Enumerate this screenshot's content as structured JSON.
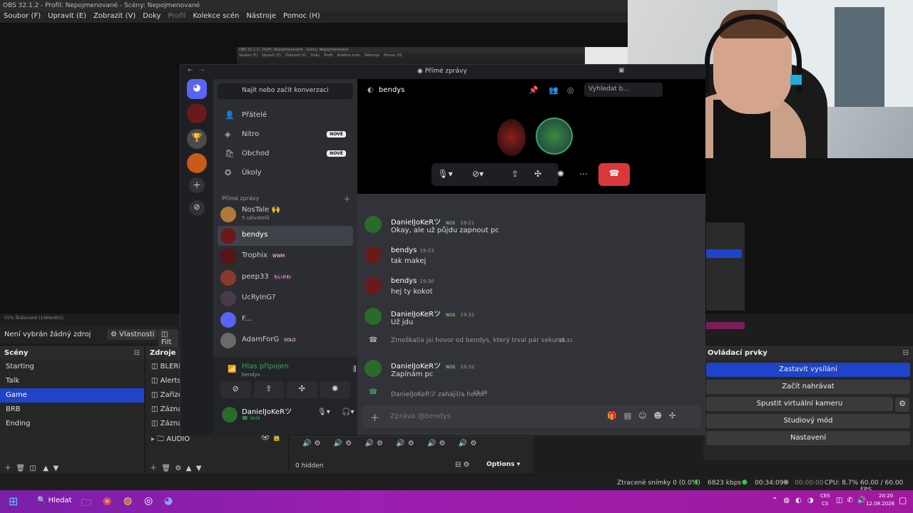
{
  "obs": {
    "title": "OBS 32.1.2 - Profil: Nepojmenované - Scény: Nepojmenované",
    "menu": [
      "Soubor (F)",
      "Upravit (E)",
      "Zobrazit (V)",
      "Doky",
      "Profil",
      "Kolekce scén",
      "Nástroje",
      "Pomoc (H)"
    ],
    "scale_text": "55%     Škálované (1069x601)",
    "no_source": "Není vybrán žádný zdroj",
    "properties_btn": "Vlastnosti",
    "filters_btn": "Filt",
    "scenes_title": "Scény",
    "scenes": [
      "Starting",
      "Talk",
      "Game",
      "BRB",
      "Ending"
    ],
    "selected_scene": "Game",
    "sources_title": "Zdroje",
    "sources": [
      "BLERP",
      "Alerts",
      "Zařízen",
      "Záznar",
      "Záznar"
    ],
    "audio_group": "AUDIO",
    "hidden_count": "0 hidden",
    "options_btn": "Options",
    "controls_title": "Ovládací prvky",
    "controls": [
      "Zastavit vysílání",
      "Začít nahrávat",
      "Spustit virtuální kameru",
      "Studiový mód",
      "Nastavení"
    ],
    "status": {
      "dropped": "Ztracené snímky 0 (0.0%)",
      "bitrate": "6823 kbps",
      "stream_time": "00:34:09",
      "rec_time": "00:00:00",
      "cpu": "CPU: 8.7%",
      "fps": "60.00 / 60.00 FPS"
    }
  },
  "discord": {
    "window_title": "Přímé zprávy",
    "search_placeholder": "Najít nebo začít konverzaci",
    "nav": [
      {
        "label": "Přátelé",
        "icon": "friends-icon",
        "badge": ""
      },
      {
        "label": "Nitro",
        "icon": "nitro-icon",
        "badge": "NOVÉ"
      },
      {
        "label": "Obchod",
        "icon": "shop-icon",
        "badge": "NOVÉ"
      },
      {
        "label": "Úkoly",
        "icon": "quests-icon",
        "badge": ""
      }
    ],
    "dm_header": "Přímé zprávy",
    "dms": [
      {
        "name": "NosTale 🙌",
        "sub": "5 uživatelů",
        "tag": "",
        "color": "#b07a3a"
      },
      {
        "name": "bendys",
        "sub": "",
        "tag": "",
        "color": "#6a1a1a"
      },
      {
        "name": "Trophix",
        "sub": "",
        "tag": "WWM",
        "color": "#5a1212"
      },
      {
        "name": "peep33",
        "sub": "",
        "tag": "ちいかわ",
        "color": "#8a3a2a"
      },
      {
        "name": "UcRyInG?",
        "sub": "",
        "tag": "",
        "color": "#4a3a4a"
      },
      {
        "name": "F...",
        "sub": "",
        "tag": "",
        "color": "#5865f2"
      },
      {
        "name": "AdamForG",
        "sub": "",
        "tag": "SOLO",
        "color": "#6a6a6a"
      }
    ],
    "voice_status": "Hlas připojen",
    "voice_channel": "bendys",
    "user_name": "DanielJoKeRツ",
    "user_status": "Volá",
    "chat_title": "bendys",
    "chat_search": "Vyhledat b...",
    "messages": [
      {
        "type": "msg",
        "author": "DanielJoKeRツ",
        "tag": "NOS",
        "time": "19:21",
        "text": "Okay, ale už půjdu zapnout pc",
        "color": "#2a6a2a"
      },
      {
        "type": "msg",
        "author": "bendys",
        "tag": "",
        "time": "19:23",
        "text": "tak makej",
        "color": "#6a1a1a"
      },
      {
        "type": "msg",
        "author": "bendys",
        "tag": "",
        "time": "19:30",
        "text": "hej ty kokot",
        "color": "#6a1a1a"
      },
      {
        "type": "msg",
        "author": "DanielJoKeRツ",
        "tag": "NOS",
        "time": "19:31",
        "text": "Už jdu",
        "color": "#2a6a2a"
      },
      {
        "type": "system",
        "text": "Zmeškal/a jsi hovor od bendys, který trval pár sekund.",
        "time": "19:31"
      },
      {
        "type": "msg",
        "author": "DanielJoKeRツ",
        "tag": "NOS",
        "time": "19:32",
        "text": "Zapínám pc",
        "color": "#2a6a2a"
      },
      {
        "type": "system",
        "text": "DanielJoKeRツ zahájil/a hovor.",
        "time": "19:39"
      }
    ],
    "composer_placeholder": "Zpráva @bendys"
  },
  "taskbar": {
    "search": "Hledat",
    "lang1": "CES",
    "lang2": "CS",
    "time": "20:20",
    "date": "12.08.2026"
  }
}
